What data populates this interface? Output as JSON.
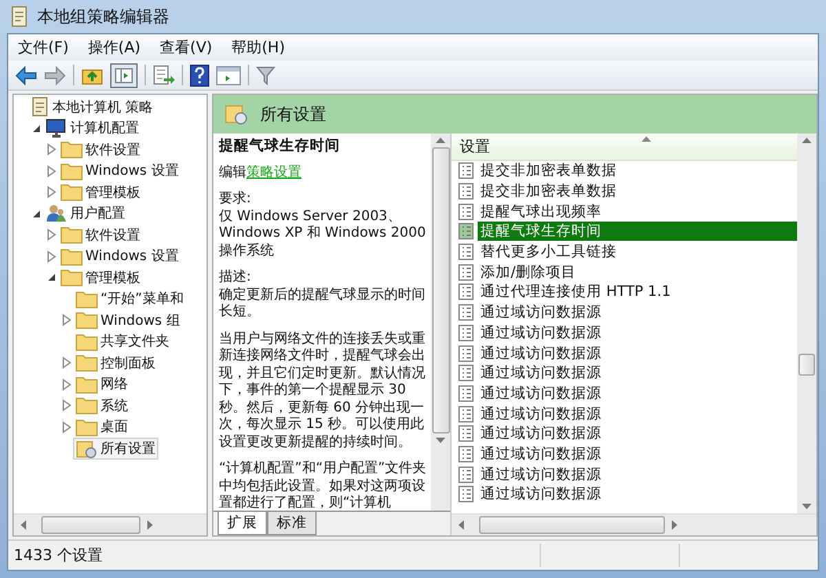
{
  "window": {
    "title": "本地组策略编辑器"
  },
  "menu": [
    "文件(F)",
    "操作(A)",
    "查看(V)",
    "帮助(H)"
  ],
  "tree": [
    {
      "label": "本地计算机 策略",
      "kind": "policy",
      "selected": false,
      "children": [
        {
          "label": "计算机配置",
          "kind": "computer",
          "expanded": true,
          "selected": false,
          "children": [
            {
              "label": "软件设置",
              "kind": "folder",
              "expanded": false,
              "selected": false
            },
            {
              "label": "Windows 设置",
              "kind": "folder",
              "expanded": false,
              "selected": false
            },
            {
              "label": "管理模板",
              "kind": "folder",
              "expanded": false,
              "selected": false
            }
          ]
        },
        {
          "label": "用户配置",
          "kind": "user",
          "expanded": true,
          "selected": false,
          "children": [
            {
              "label": "软件设置",
              "kind": "folder",
              "expanded": false,
              "selected": false
            },
            {
              "label": "Windows 设置",
              "kind": "folder",
              "expanded": false,
              "selected": false
            },
            {
              "label": "管理模板",
              "kind": "folder",
              "expanded": true,
              "selected": false,
              "children": [
                {
                  "label": "“开始”菜单和",
                  "kind": "folder",
                  "selected": false
                },
                {
                  "label": "Windows 组",
                  "kind": "folder",
                  "expanded": false,
                  "selected": false
                },
                {
                  "label": "共享文件夹",
                  "kind": "folder",
                  "selected": false
                },
                {
                  "label": "控制面板",
                  "kind": "folder",
                  "expanded": false,
                  "selected": false
                },
                {
                  "label": "网络",
                  "kind": "folder",
                  "expanded": false,
                  "selected": false
                },
                {
                  "label": "系统",
                  "kind": "folder",
                  "expanded": false,
                  "selected": false
                },
                {
                  "label": "桌面",
                  "kind": "folder",
                  "expanded": false,
                  "selected": false
                },
                {
                  "label": "所有设置",
                  "kind": "settings",
                  "selected": true
                }
              ]
            }
          ]
        }
      ]
    }
  ],
  "details": {
    "header": "所有设置",
    "title": "提醒气球生存时间",
    "edit_prefix": "编辑",
    "edit_link": "策略设置",
    "paragraphs": [
      "要求:\n仅 Windows Server 2003、Windows XP 和 Windows 2000 操作系统",
      "描述:\n确定更新后的提醒气球显示的时间长短。",
      "当用户与网络文件的连接丢失或重新连接网络文件时，提醒气球会出现，并且它们定时更新。默认情况下，事件的第一个提醒显示 30 秒。然后，更新每 60 分钟出现一次，每次显示 15 秒。可以使用此设置更改更新提醒的持续时间。",
      "“计算机配置”和“用户配置”文件夹中均包括此设置。如果对这两项设置都进行了配置，则“计算机"
    ],
    "tabs": [
      {
        "label": "扩展",
        "selected": true
      },
      {
        "label": "标准",
        "selected": false
      }
    ]
  },
  "list": {
    "column": "设置",
    "rows": [
      {
        "label": "提交非加密表单数据",
        "selected": false
      },
      {
        "label": "提交非加密表单数据",
        "selected": false
      },
      {
        "label": "提醒气球出现频率",
        "selected": false
      },
      {
        "label": "提醒气球生存时间",
        "selected": true
      },
      {
        "label": "替代更多小工具链接",
        "selected": false
      },
      {
        "label": "添加/删除项目",
        "selected": false
      },
      {
        "label": "通过代理连接使用 HTTP 1.1",
        "selected": false
      },
      {
        "label": "通过域访问数据源",
        "selected": false
      },
      {
        "label": "通过域访问数据源",
        "selected": false
      },
      {
        "label": "通过域访问数据源",
        "selected": false
      },
      {
        "label": "通过域访问数据源",
        "selected": false
      },
      {
        "label": "通过域访问数据源",
        "selected": false
      },
      {
        "label": "通过域访问数据源",
        "selected": false
      },
      {
        "label": "通过域访问数据源",
        "selected": false
      },
      {
        "label": "通过域访问数据源",
        "selected": false
      },
      {
        "label": "通过域访问数据源",
        "selected": false
      },
      {
        "label": "通过域访问数据源",
        "selected": false
      }
    ]
  },
  "status_bar": {
    "text": "1433 个设置"
  }
}
